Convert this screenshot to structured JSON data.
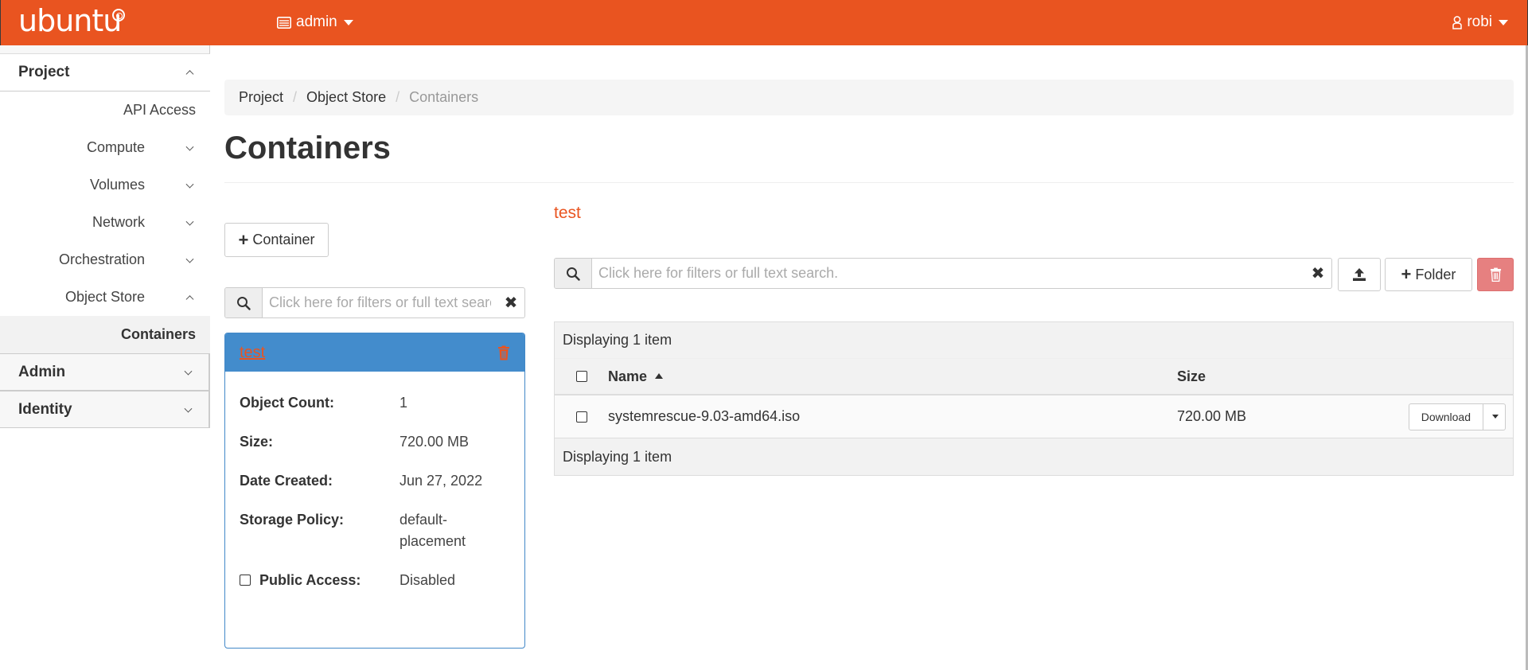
{
  "topbar": {
    "brand": "ubuntu",
    "project_label": "admin",
    "user_label": "robi"
  },
  "sidebar": {
    "project": "Project",
    "items": {
      "api_access": "API Access",
      "compute": "Compute",
      "volumes": "Volumes",
      "network": "Network",
      "orchestration": "Orchestration",
      "object_store": "Object Store",
      "containers": "Containers"
    },
    "admin": "Admin",
    "identity": "Identity"
  },
  "breadcrumb": {
    "project": "Project",
    "object_store": "Object Store",
    "current": "Containers"
  },
  "page": {
    "title": "Containers",
    "add_container_label": "Container"
  },
  "container_search": {
    "placeholder": "Click here for filters or full text search."
  },
  "container_card": {
    "name": "test",
    "object_count_label": "Object Count:",
    "object_count": "1",
    "size_label": "Size:",
    "size": "720.00 MB",
    "date_created_label": "Date Created:",
    "date_created": "Jun 27, 2022",
    "storage_policy_label": "Storage Policy:",
    "storage_policy_1": "default-",
    "storage_policy_2": "placement",
    "public_access_label": "Public Access:",
    "public_access": "Disabled"
  },
  "objects": {
    "container_title": "test",
    "search_placeholder": "Click here for filters or full text search.",
    "folder_label": "Folder",
    "displaying": "Displaying 1 item",
    "col_name": "Name",
    "col_size": "Size",
    "rows": [
      {
        "name": "systemrescue-9.03-amd64.iso",
        "size": "720.00 MB",
        "action": "Download"
      }
    ]
  },
  "colors": {
    "brand": "#e95420",
    "card_header": "#438ccc",
    "danger": "#e68080"
  }
}
